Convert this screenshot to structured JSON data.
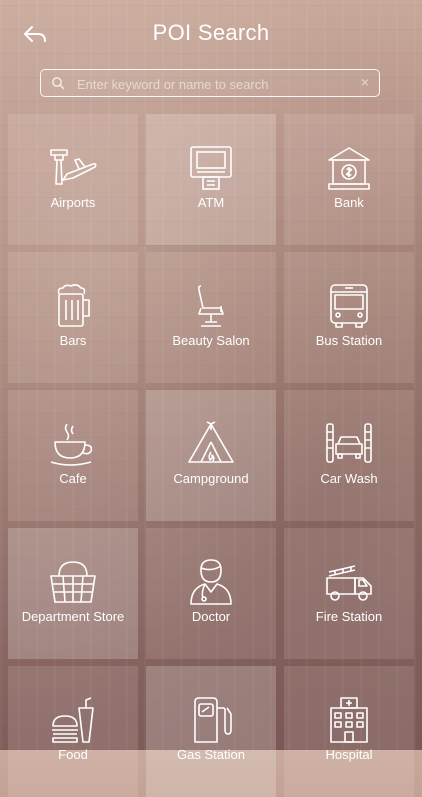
{
  "header": {
    "title": "POI Search",
    "back_icon": "back-arrow-icon"
  },
  "search": {
    "placeholder": "Enter keyword or name to search",
    "value": "",
    "clear_symbol": "×"
  },
  "tiles": [
    {
      "label": "Airports",
      "icon": "airport-icon"
    },
    {
      "label": "ATM",
      "icon": "atm-icon"
    },
    {
      "label": "Bank",
      "icon": "bank-icon"
    },
    {
      "label": "Bars",
      "icon": "beer-mug-icon"
    },
    {
      "label": "Beauty Salon",
      "icon": "salon-chair-icon"
    },
    {
      "label": "Bus Station",
      "icon": "bus-icon"
    },
    {
      "label": "Cafe",
      "icon": "coffee-cup-icon"
    },
    {
      "label": "Campground",
      "icon": "tent-icon"
    },
    {
      "label": "Car Wash",
      "icon": "car-wash-icon"
    },
    {
      "label": "Department Store",
      "icon": "basket-icon"
    },
    {
      "label": "Doctor",
      "icon": "doctor-icon"
    },
    {
      "label": "Fire Station",
      "icon": "fire-truck-icon"
    },
    {
      "label": "Food",
      "icon": "burger-drink-icon"
    },
    {
      "label": "Gas Station",
      "icon": "gas-pump-icon"
    },
    {
      "label": "Hospital",
      "icon": "hospital-icon"
    }
  ]
}
